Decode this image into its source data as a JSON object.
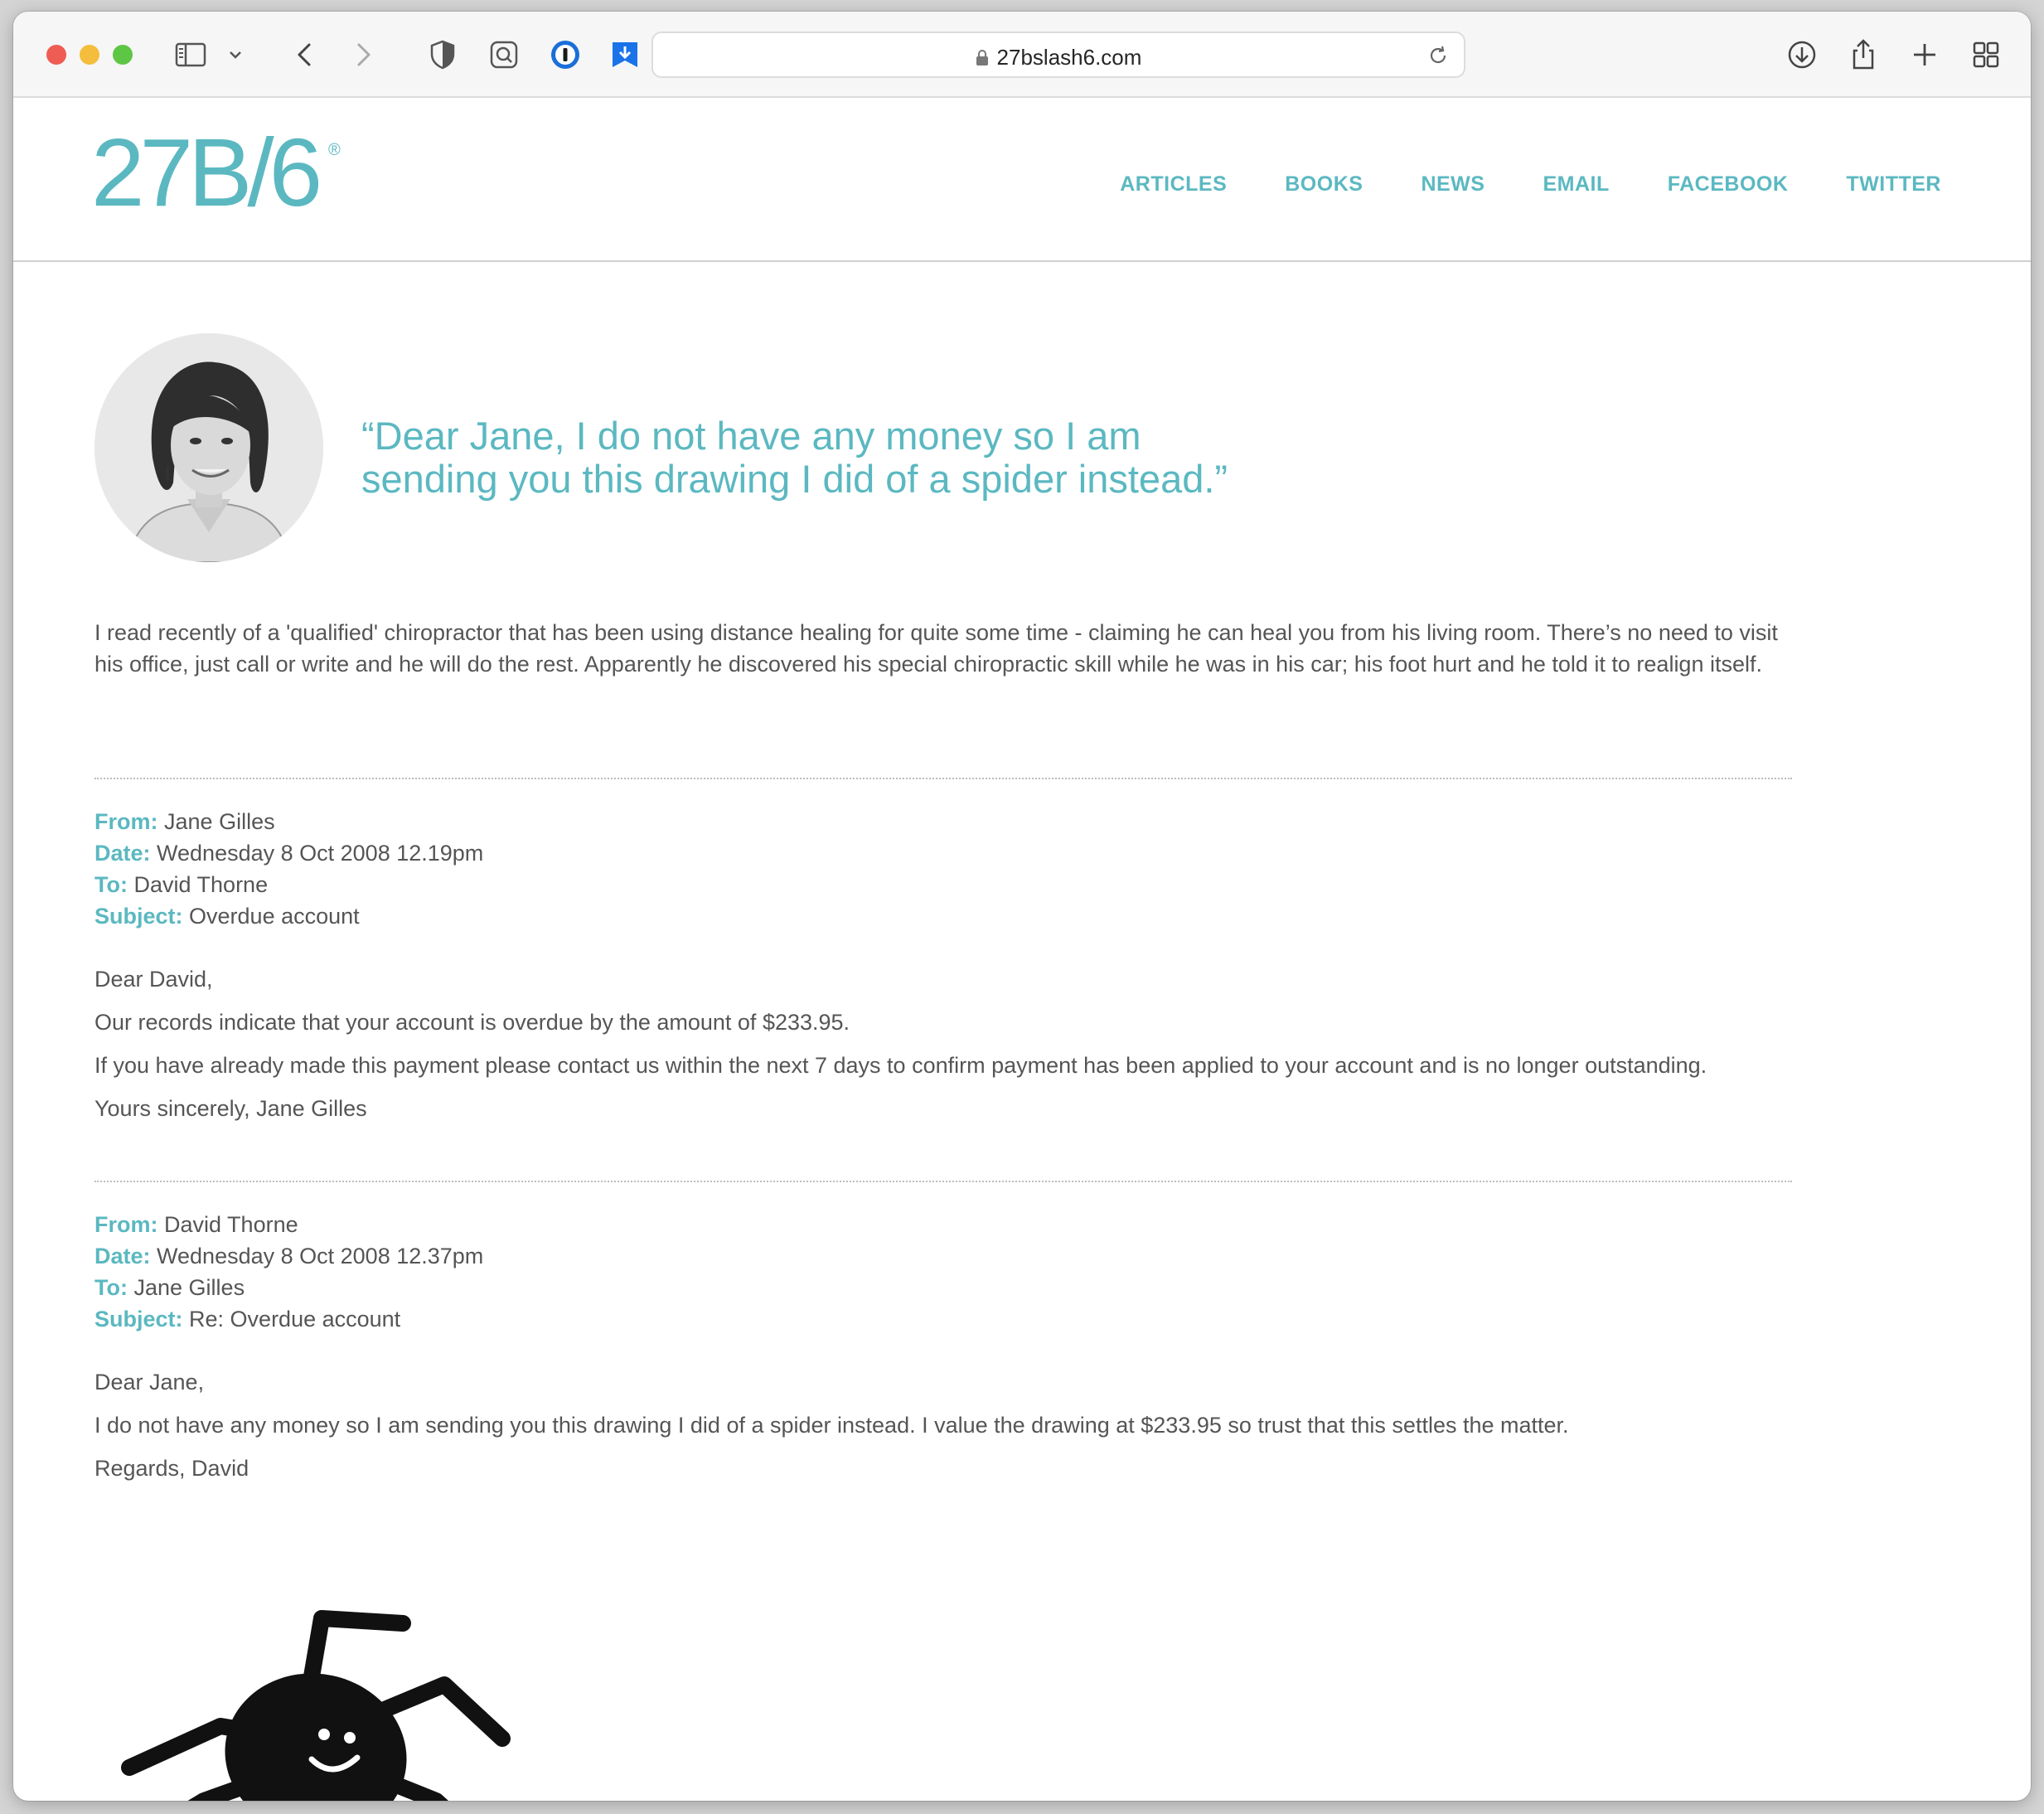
{
  "browser": {
    "url": "27bslash6.com"
  },
  "site": {
    "logo": "27B/6",
    "logo_mark": "®",
    "nav": [
      {
        "label": "ARTICLES"
      },
      {
        "label": "BOOKS"
      },
      {
        "label": "NEWS"
      },
      {
        "label": "EMAIL"
      },
      {
        "label": "FACEBOOK"
      },
      {
        "label": "TWITTER"
      }
    ]
  },
  "article": {
    "quote_line1": "“Dear Jane, I do not have any money so I am",
    "quote_line2": "sending you this drawing I did of a spider instead.”",
    "intro": "I read recently of a 'qualified' chiropractor that has been using distance healing for quite some time - claiming he can heal you from his living room. There’s no need to visit his office, just call or write and he will do the rest. Apparently he discovered his special chiropractic skill while he was in his car; his foot hurt and he told it to realign itself."
  },
  "labels": {
    "from": "From:",
    "date": "Date:",
    "to": "To:",
    "subject": "Subject:"
  },
  "emails": [
    {
      "from": "Jane Gilles",
      "date": "Wednesday 8 Oct 2008 12.19pm",
      "to": "David Thorne",
      "subject": "Overdue account",
      "greeting": "Dear David,",
      "body1": "Our records indicate that your account is overdue by the amount of $233.95.",
      "body2": "If you have already made this payment please contact us within the next 7 days to confirm payment has been applied to your account and is no longer outstanding.",
      "signoff": "Yours sincerely, Jane Gilles"
    },
    {
      "from": "David Thorne",
      "date": "Wednesday 8 Oct 2008 12.37pm",
      "to": "Jane Gilles",
      "subject": "Re: Overdue account",
      "greeting": "Dear Jane,",
      "body1": "I do not have any money so I am sending you this drawing I did of a spider instead. I value the drawing at $233.95 so trust that this settles the matter.",
      "signoff": "Regards, David"
    }
  ],
  "icons": {
    "sidebar": "sidebar-icon",
    "back": "chevron-left-icon",
    "forward": "chevron-right-icon",
    "privacy": "shield-icon",
    "extension": "search-extension-icon",
    "password": "1password-icon",
    "bookmark": "bookmark-download-icon",
    "downloads": "download-icon",
    "share": "share-icon",
    "new_tab": "plus-icon",
    "tabs": "tab-overview-icon"
  },
  "colors": {
    "accent": "#5bb8c1",
    "text": "#555555"
  }
}
